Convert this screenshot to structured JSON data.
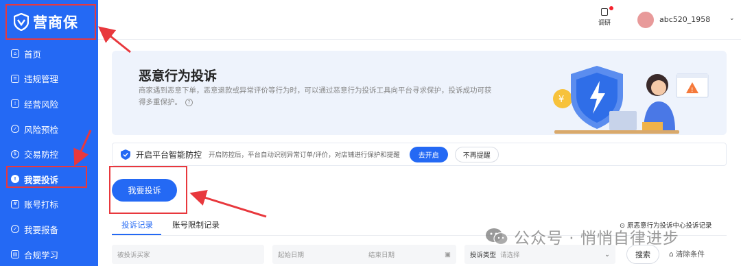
{
  "app": {
    "logo_text": "营商保"
  },
  "sidebar": {
    "items": [
      {
        "label": "首页",
        "icon": "home-icon"
      },
      {
        "label": "违规管理",
        "icon": "violation-icon"
      },
      {
        "label": "经营风险",
        "icon": "risk-icon"
      },
      {
        "label": "风险预检",
        "icon": "precheck-icon"
      },
      {
        "label": "交易防控",
        "icon": "trade-guard-icon"
      },
      {
        "label": "我要投诉",
        "icon": "alert-icon",
        "active": true
      },
      {
        "label": "账号打标",
        "icon": "tag-icon"
      },
      {
        "label": "我要报备",
        "icon": "report-icon"
      },
      {
        "label": "合规学习",
        "icon": "study-icon"
      }
    ]
  },
  "header": {
    "research_label": "调研",
    "username": "abc520_1958",
    "caret": "⌄"
  },
  "banner": {
    "title": "恶意行为投诉",
    "desc": "商家遇到恶意下单，恶意退款或异常评价等行为时，可以通过恶意行为投诉工具向平台寻求保护，投诉成功可获得多重保护。",
    "help": "?"
  },
  "notice": {
    "title": "开启平台智能防控",
    "desc": "开启防控后，平台自动识别异常订单/评价，对店铺进行保护和提醒",
    "open_label": "去开启",
    "dismiss_label": "不再提醒"
  },
  "complain_button": "我要投诉",
  "tabs": [
    {
      "label": "投诉记录",
      "active": true
    },
    {
      "label": "账号限制记录",
      "active": false
    }
  ],
  "legacy_link": "原恶意行为投诉中心投诉记录",
  "filters": {
    "buyer_placeholder": "被投诉买家",
    "start_date": "起始日期",
    "end_date": "结束日期",
    "type_label": "投诉类型",
    "type_placeholder": "请选择",
    "search_label": "搜索",
    "clear_label": "清除条件"
  },
  "watermark": "公众号 · 悄悄自律进步",
  "colors": {
    "primary": "#2469f4",
    "annotation": "#e8383d"
  }
}
